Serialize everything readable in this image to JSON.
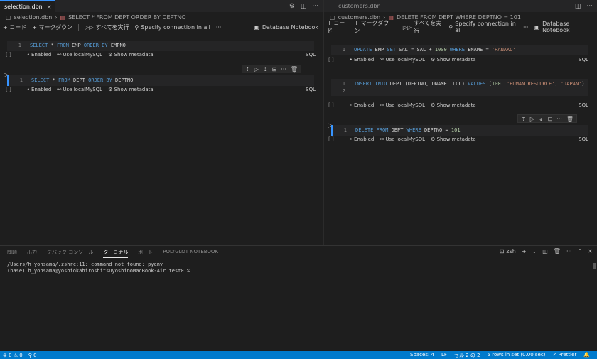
{
  "left_group": {
    "tab": {
      "label": "selection.dbn",
      "close": "×"
    },
    "tab_actions": [
      "⚙",
      "◫",
      "···"
    ],
    "breadcrumb": {
      "file": "selection.dbn",
      "separator": "›",
      "cell": "SELECT * FROM DEPT ORDER BY DEPTNO"
    },
    "toolbar": {
      "add_code": "+ コード",
      "add_markdown": "+ マークダウン",
      "run_all": "すべてを実行",
      "connection": "Specify connection in all",
      "more": "···",
      "kernel": "Database Notebook"
    },
    "cells": [
      {
        "line_no": "1",
        "tokens": {
          "k1": "SELECT",
          "t1": " * ",
          "k2": "FROM",
          "t2": " EMP ",
          "k3": "ORDER BY",
          "t3": " EMPNO"
        },
        "status": {
          "bracket": "[ ]",
          "enabled": "Enabled",
          "use": "Use localMySQL",
          "meta": "Show metadata",
          "lang": "SQL"
        }
      },
      {
        "line_no": "1",
        "tokens": {
          "k1": "SELECT",
          "t1": " * ",
          "k2": "FROM",
          "t2": " DEPT ",
          "k3": "ORDER BY",
          "t3": " DEPTNO"
        },
        "status": {
          "bracket": "[ ]",
          "enabled": "Enabled",
          "use": "Use localMySQL",
          "meta": "Show metadata",
          "lang": "SQL"
        }
      }
    ]
  },
  "right_group": {
    "tab": {
      "label": "customers.dbn"
    },
    "tab_actions": [
      "◫",
      "···"
    ],
    "breadcrumb": {
      "file": "customers.dbn",
      "separator": "›",
      "cell": "DELETE FROM DEPT WHERE DEPTNO = 101"
    },
    "toolbar": {
      "add_code": "+ コード",
      "add_markdown": "+ マークダウン",
      "run_all": "すべてを実行",
      "connection": "Specify connection in all",
      "more": "···",
      "kernel": "Database Notebook"
    },
    "cells": [
      {
        "line_no": "1",
        "tokens": {
          "k1": "UPDATE",
          "t1": " EMP ",
          "k2": "SET",
          "t2": " SAL = SAL + ",
          "n1": "1000",
          "t3": " ",
          "k3": "WHERE",
          "t4": " ENAME = ",
          "s1": "'HANAKO'"
        },
        "status": {
          "bracket": "[ ]",
          "enabled": "Enabled",
          "use": "Use localMySQL",
          "meta": "Show metadata",
          "lang": "SQL"
        }
      },
      {
        "line_no": "1",
        "line2_no": "2",
        "tokens": {
          "k1": "INSERT",
          "t1": " ",
          "k2": "INTO",
          "t2": " DEPT (DEPTNO, DNAME, LOC) ",
          "k3": "VALUES",
          "t3": " (",
          "n1": "100",
          "t4": ", ",
          "s1": "'HUMAN RESOURCE'",
          "t5": ", ",
          "s2": "'JAPAN'",
          "t6": ")"
        },
        "status": {
          "bracket": "[ ]",
          "enabled": "Enabled",
          "use": "Use localMySQL",
          "meta": "Show metadata",
          "lang": "SQL"
        }
      },
      {
        "line_no": "1",
        "tokens": {
          "k1": "DELETE",
          "t1": " ",
          "k2": "FROM",
          "t2": " DEPT ",
          "k3": "WHERE",
          "t3": " DEPTNO = ",
          "n1": "101"
        },
        "status": {
          "bracket": "[ ]",
          "enabled": "Enabled",
          "use": "Use localMySQL",
          "meta": "Show metadata",
          "lang": "SQL"
        }
      }
    ]
  },
  "panel": {
    "tabs": [
      "問題",
      "出力",
      "デバッグ コンソール",
      "ターミナル",
      "ポート",
      "POLYGLOT NOTEBOOK"
    ],
    "active_tab": "ターミナル",
    "shell": "zsh",
    "terminal_lines": [
      "/Users/h_yonsama/.zshrc:11: command not found: pyenv",
      "(base) h_yonsama@yoshiokahiroshitsuyoshinoMacBook-Air test0 %"
    ]
  },
  "statusbar": {
    "problems": "⊗ 0 ⚠ 0",
    "ports": "⚲ 0",
    "spaces": "Spaces: 4",
    "eol": "LF",
    "cell": "セル 2 の 2",
    "rows": "5 rows in set (0.00 sec)",
    "prettier": "✓ Prettier",
    "bell": "🔔"
  },
  "colors": {
    "accent": "#007acc",
    "keyword": "#569cd6",
    "string": "#ce9178",
    "number": "#b5cea8"
  }
}
